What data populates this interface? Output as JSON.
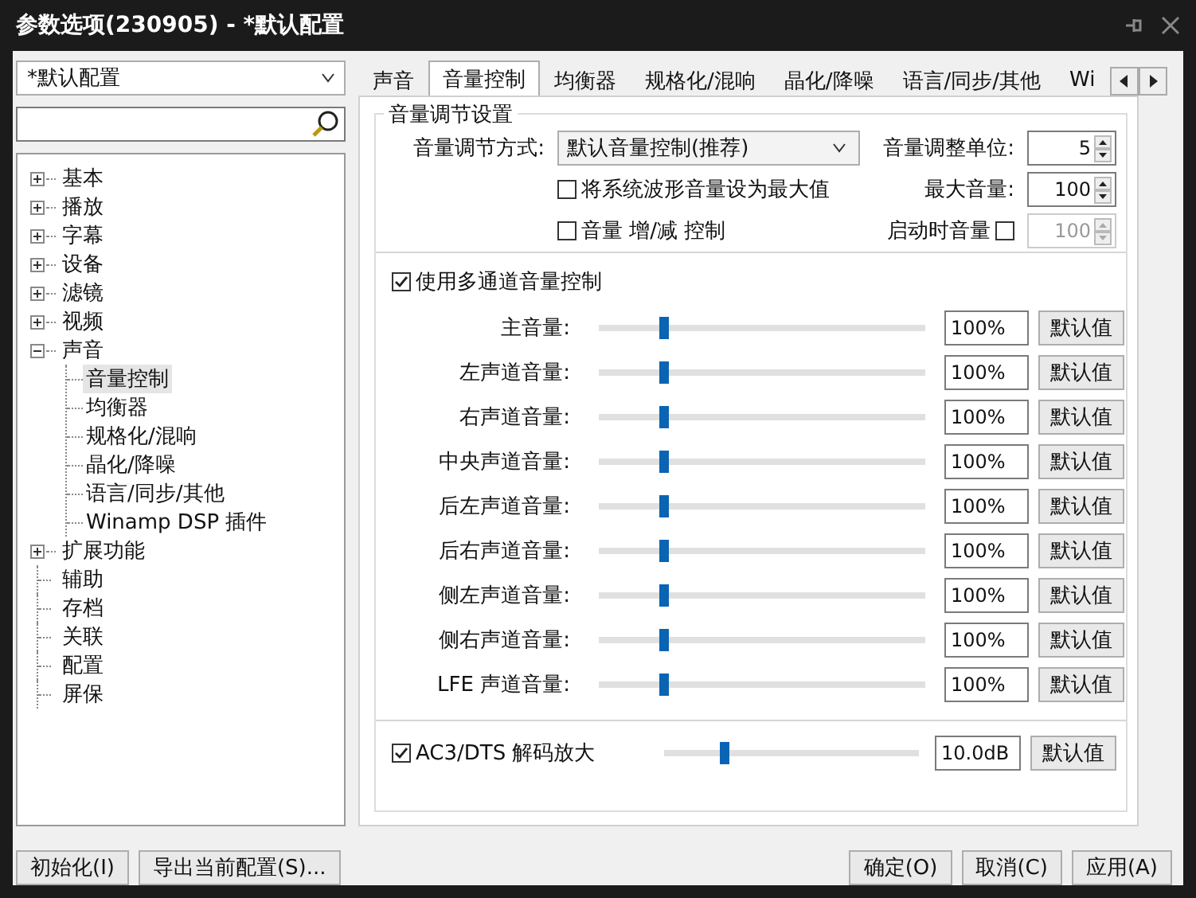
{
  "window": {
    "title": "参数选项(230905) - *默认配置"
  },
  "profile_select": {
    "value": "*默认配置"
  },
  "tree": [
    {
      "label": "基本",
      "expanded": false,
      "selected": false
    },
    {
      "label": "播放",
      "expanded": false,
      "selected": false
    },
    {
      "label": "字幕",
      "expanded": false,
      "selected": false
    },
    {
      "label": "设备",
      "expanded": false,
      "selected": false
    },
    {
      "label": "滤镜",
      "expanded": false,
      "selected": false
    },
    {
      "label": "视频",
      "expanded": false,
      "selected": false
    },
    {
      "label": "声音",
      "expanded": true,
      "selected": false,
      "children": [
        {
          "label": "音量控制",
          "selected": true
        },
        {
          "label": "均衡器",
          "selected": false
        },
        {
          "label": "规格化/混响",
          "selected": false
        },
        {
          "label": "晶化/降噪",
          "selected": false
        },
        {
          "label": "语言/同步/其他",
          "selected": false
        },
        {
          "label": "Winamp DSP 插件",
          "selected": false
        }
      ]
    },
    {
      "label": "扩展功能",
      "expanded": false,
      "selected": false
    },
    {
      "label": "辅助",
      "selected": false
    },
    {
      "label": "存档",
      "selected": false
    },
    {
      "label": "关联",
      "selected": false
    },
    {
      "label": "配置",
      "selected": false
    },
    {
      "label": "屏保",
      "selected": false
    }
  ],
  "tabs": [
    {
      "label": "声音",
      "selected": false
    },
    {
      "label": "音量控制",
      "selected": true
    },
    {
      "label": "均衡器",
      "selected": false
    },
    {
      "label": "规格化/混响",
      "selected": false
    },
    {
      "label": "晶化/降噪",
      "selected": false
    },
    {
      "label": "语言/同步/其他",
      "selected": false
    },
    {
      "label": "Wi",
      "selected": false
    }
  ],
  "volume_settings": {
    "title": "音量调节设置",
    "mode_label": "音量调节方式:",
    "mode_value": "默认音量控制(推荐)",
    "options": [
      {
        "label": "将系统波形音量设为最大值",
        "checked": false
      },
      {
        "label": "音量 增/减 控制",
        "checked": false
      }
    ],
    "step": {
      "label": "音量调整单位:",
      "value": "5"
    },
    "max": {
      "label": "最大音量:",
      "value": "100"
    },
    "startup": {
      "label": "启动时音量",
      "checked": false,
      "value": "100",
      "disabled": true
    }
  },
  "multichannel": {
    "label": "使用多通道音量控制",
    "checked": true,
    "channels": [
      {
        "name": "主音量:",
        "level": 0.2,
        "reading": "100%",
        "button": "默认值"
      },
      {
        "name": "左声道音量:",
        "level": 0.2,
        "reading": "100%",
        "button": "默认值"
      },
      {
        "name": "右声道音量:",
        "level": 0.2,
        "reading": "100%",
        "button": "默认值"
      },
      {
        "name": "中央声道音量:",
        "level": 0.2,
        "reading": "100%",
        "button": "默认值"
      },
      {
        "name": "后左声道音量:",
        "level": 0.2,
        "reading": "100%",
        "button": "默认值"
      },
      {
        "name": "后右声道音量:",
        "level": 0.2,
        "reading": "100%",
        "button": "默认值"
      },
      {
        "name": "侧左声道音量:",
        "level": 0.2,
        "reading": "100%",
        "button": "默认值"
      },
      {
        "name": "侧右声道音量:",
        "level": 0.2,
        "reading": "100%",
        "button": "默认值"
      },
      {
        "name": "LFE 声道音量:",
        "level": 0.2,
        "reading": "100%",
        "button": "默认值"
      }
    ]
  },
  "ac3": {
    "label": "AC3/DTS 解码放大",
    "checked": true,
    "level": 0.24,
    "reading": "10.0dB",
    "button": "默认值"
  },
  "buttons_left": [
    "初始化(I)",
    "导出当前配置(S)..."
  ],
  "buttons_right": [
    "确定(O)",
    "取消(C)",
    "应用(A)"
  ]
}
